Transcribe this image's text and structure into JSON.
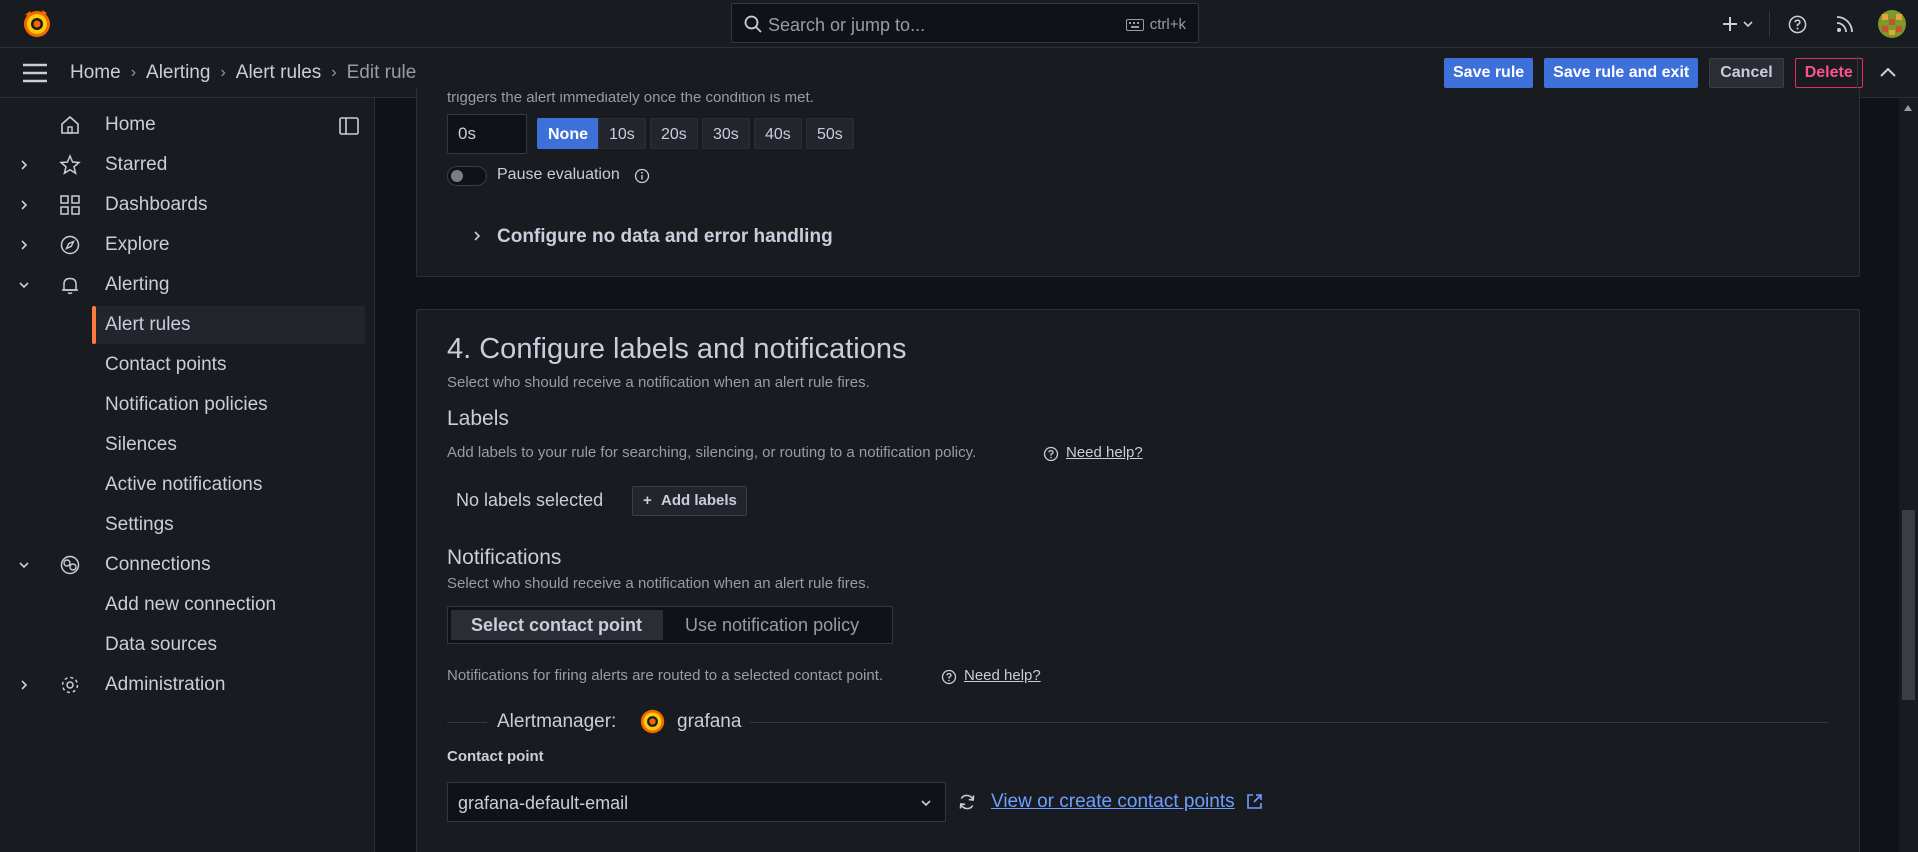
{
  "topbar": {
    "search_placeholder": "Search or jump to...",
    "search_shortcut": "ctrl+k",
    "icons": [
      "grafana-logo-icon",
      "search-icon",
      "keyboard-icon",
      "plus-icon",
      "chevron-down-icon",
      "help-icon",
      "news-icon",
      "avatar"
    ]
  },
  "breadcrumbs": [
    "Home",
    "Alerting",
    "Alert rules",
    "Edit rule"
  ],
  "actions": {
    "save": "Save rule",
    "save_exit": "Save rule and exit",
    "cancel": "Cancel",
    "delete": "Delete"
  },
  "sidebar": {
    "items": [
      {
        "label": "Home",
        "icon": "home-icon"
      },
      {
        "label": "Starred",
        "icon": "star-icon"
      },
      {
        "label": "Dashboards",
        "icon": "apps-icon"
      },
      {
        "label": "Explore",
        "icon": "compass-icon"
      },
      {
        "label": "Alerting",
        "icon": "bell-icon"
      },
      {
        "label": "Connections",
        "icon": "connections-icon"
      },
      {
        "label": "Administration",
        "icon": "gear-icon"
      }
    ],
    "alerting_children": [
      "Alert rules",
      "Contact points",
      "Notification policies",
      "Silences",
      "Active notifications",
      "Settings"
    ],
    "connections_children": [
      "Add new connection",
      "Data sources"
    ],
    "active": "Alert rules"
  },
  "evaluation": {
    "truncated_text": "triggers the alert immediately once the condition is met.",
    "pending_value": "0s",
    "pending_options": [
      "None",
      "10s",
      "20s",
      "30s",
      "40s",
      "50s"
    ],
    "pending_selected": "None",
    "pause_label": "Pause evaluation",
    "pause_on": false,
    "no_data_link": "Configure no data and error handling"
  },
  "section4": {
    "title": "4. Configure labels and notifications",
    "description": "Select who should receive a notification when an alert rule fires.",
    "labels_heading": "Labels",
    "labels_desc": "Add labels to your rule for searching, silencing, or routing to a notification policy.",
    "need_help": "Need help?",
    "no_labels": "No labels selected",
    "add_labels": "Add labels",
    "notifications_heading": "Notifications",
    "notifications_desc": "Select who should receive a notification when an alert rule fires.",
    "routing_options": [
      "Select contact point",
      "Use notification policy"
    ],
    "routing_selected": "Select contact point",
    "routing_desc": "Notifications for firing alerts are routed to a selected contact point.",
    "alertmanager_label": "Alertmanager:",
    "alertmanager_name": "grafana",
    "contact_point_label": "Contact point",
    "contact_point_value": "grafana-default-email",
    "contact_points_link": "View or create contact points"
  },
  "colors": {
    "primary": "#3d71d9",
    "danger": "#ff5286",
    "active_indicator": "#ff7a3d",
    "link": "#6e9fff",
    "background": "#111217",
    "panel": "#181b1f"
  }
}
